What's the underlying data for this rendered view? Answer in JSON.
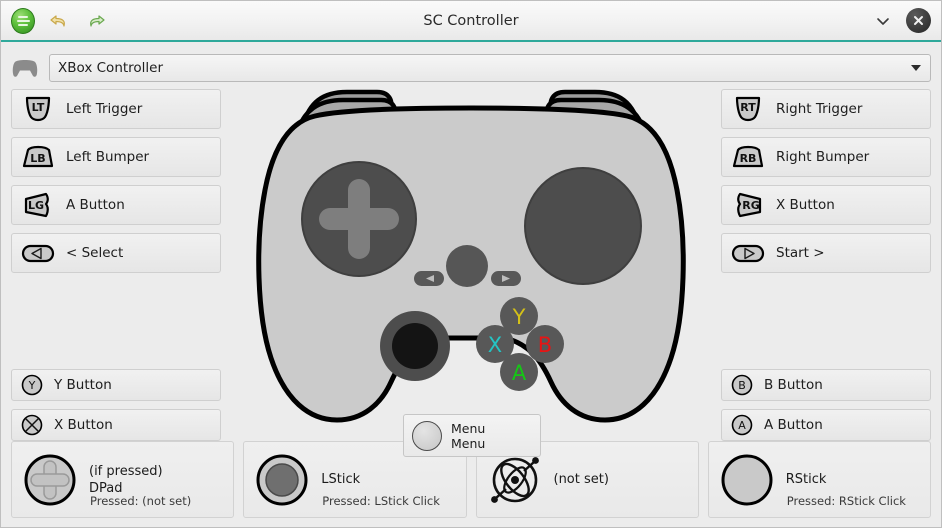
{
  "window": {
    "title": "SC Controller",
    "app_icon": "sc-controller-logo-icon",
    "undo_icon": "undo-arrow-icon",
    "redo_icon": "redo-arrow-icon",
    "menu_chevron_icon": "chevron-down-icon",
    "close_icon": "close-icon",
    "accent_color": "#2fa99b"
  },
  "controller_select": {
    "icon": "gamepad-icon",
    "value": "XBox Controller",
    "caret_icon": "caret-down-icon"
  },
  "left_bindings": [
    {
      "icon": "trigger-lt-icon",
      "icon_text": "LT",
      "label": "Left Trigger"
    },
    {
      "icon": "bumper-lb-icon",
      "icon_text": "LB",
      "label": "Left Bumper"
    },
    {
      "icon": "grip-lg-icon",
      "icon_text": "LG",
      "label": "A Button"
    },
    {
      "icon": "select-back-icon",
      "icon_text": "",
      "label": "< Select"
    }
  ],
  "left_lower_bindings": [
    {
      "icon": "y-button-icon",
      "icon_text": "Y",
      "label": "Y Button"
    },
    {
      "icon": "x-button-icon",
      "icon_text": "X",
      "label": "X Button"
    }
  ],
  "right_bindings": [
    {
      "icon": "trigger-rt-icon",
      "icon_text": "RT",
      "label": "Right Trigger"
    },
    {
      "icon": "bumper-rb-icon",
      "icon_text": "RB",
      "label": "Right Bumper"
    },
    {
      "icon": "grip-rg-icon",
      "icon_text": "RG",
      "label": "X Button"
    },
    {
      "icon": "start-icon",
      "icon_text": "",
      "label": "Start >"
    }
  ],
  "right_lower_bindings": [
    {
      "icon": "b-button-icon",
      "icon_text": "B",
      "label": "B Button"
    },
    {
      "icon": "a-button-icon",
      "icon_text": "A",
      "label": "A Button"
    }
  ],
  "controller_graphic": {
    "face_buttons": [
      {
        "name": "Y",
        "color": "#d4c118"
      },
      {
        "name": "X",
        "color": "#24c4c4"
      },
      {
        "name": "B",
        "color": "#e81414"
      },
      {
        "name": "A",
        "color": "#14c814"
      }
    ],
    "body_color": "#cbcbcb",
    "pad_color": "#4d4d4d",
    "outline_color": "#000000"
  },
  "menu_tooltip": {
    "line1": "Menu",
    "line2": "Menu",
    "icon": "menu-button-icon"
  },
  "bottom_panes": [
    {
      "icon": "dpad-icon",
      "line1": "(if pressed)",
      "line2": "DPad",
      "sub": "Pressed: (not set)"
    },
    {
      "icon": "lstick-icon",
      "line1": "LStick",
      "line2": "",
      "sub": "Pressed: LStick Click"
    },
    {
      "icon": "gyro-atom-icon",
      "line1": "(not set)",
      "line2": "",
      "sub": ""
    },
    {
      "icon": "rstick-icon",
      "line1": "RStick",
      "line2": "",
      "sub": "Pressed: RStick Click"
    }
  ]
}
